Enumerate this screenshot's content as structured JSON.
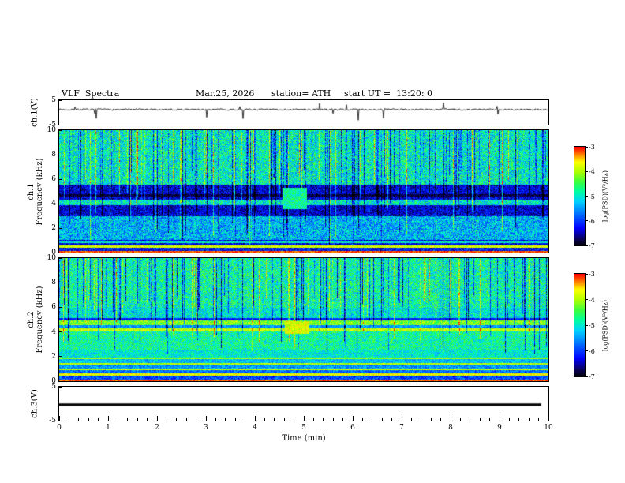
{
  "chart_data": {
    "type": "heatmap",
    "title": "VLF  Spectra",
    "header": {
      "date": "Mar.25, 2026",
      "station": "station= ATH",
      "start_ut": "start UT =  13:20: 0"
    },
    "xlabel": "Time  (min)",
    "x_range": [
      0,
      10
    ],
    "x_ticks": [
      0,
      1,
      2,
      3,
      4,
      5,
      6,
      7,
      8,
      9,
      10
    ],
    "x_minor_step": 0.2,
    "colorbar": {
      "label": "log(PSD)(V²/Hz)",
      "ticks": [
        -3,
        -4,
        -5,
        -6,
        -7
      ],
      "range": [
        -7,
        -3
      ]
    },
    "colormap_stops": [
      {
        "t": 0.0,
        "c": [
          0,
          0,
          0
        ]
      },
      {
        "t": 0.07,
        "c": [
          10,
          0,
          90
        ]
      },
      {
        "t": 0.18,
        "c": [
          0,
          0,
          255
        ]
      },
      {
        "t": 0.32,
        "c": [
          0,
          110,
          255
        ]
      },
      {
        "t": 0.45,
        "c": [
          0,
          210,
          255
        ]
      },
      {
        "t": 0.55,
        "c": [
          0,
          255,
          160
        ]
      },
      {
        "t": 0.65,
        "c": [
          60,
          255,
          60
        ]
      },
      {
        "t": 0.75,
        "c": [
          175,
          255,
          0
        ]
      },
      {
        "t": 0.85,
        "c": [
          255,
          255,
          0
        ]
      },
      {
        "t": 0.93,
        "c": [
          255,
          120,
          0
        ]
      },
      {
        "t": 1.0,
        "c": [
          255,
          0,
          0
        ]
      }
    ],
    "panels": [
      {
        "kind": "waveform",
        "ylabel": "ch.1(V)",
        "ylim": [
          -5,
          5
        ],
        "yticks": [
          5,
          -5
        ],
        "baseline": 1.2,
        "noise": 0.35,
        "spike_down_rate": 0.015,
        "spike_up_rate": 0.009,
        "seed": 7
      },
      {
        "kind": "spectrogram",
        "ylabel1": "ch.1",
        "ylabel2": "Frequency (kHz)",
        "ylim": [
          0,
          10
        ],
        "yticks": [
          0,
          2,
          4,
          6,
          8,
          10
        ],
        "seed": 11,
        "base": [
          -5.0,
          0.8
        ],
        "bands": [
          [
            0,
            0.15,
            -3.2,
            0.25
          ],
          [
            0.15,
            1.05,
            -6.2,
            0.55
          ],
          [
            0.45,
            0.62,
            -3.8,
            0.35
          ],
          [
            0.8,
            0.95,
            -5.0,
            0.5
          ],
          [
            1.05,
            3.0,
            -5.35,
            0.7
          ],
          [
            3.0,
            5.6,
            -6.35,
            0.5
          ],
          [
            3.9,
            4.35,
            -5.0,
            0.7
          ],
          [
            4.6,
            4.78,
            -6.8,
            0.25
          ],
          [
            5.6,
            10,
            -4.95,
            0.75
          ]
        ],
        "streaks": {
          "bright_rate": 0.1,
          "dark_rate": 0.16,
          "bright_delta": 1.25,
          "dark_delta": -1.35,
          "fmin": 0.6,
          "fmax": 7
        },
        "event": {
          "t0": 4.55,
          "t1": 5.05,
          "f0": 3.6,
          "f1": 5.3,
          "v": -4.8,
          "jit": 0.5
        }
      },
      {
        "kind": "spectrogram",
        "ylabel1": "ch.2",
        "ylabel2": "Frequency (kHz)",
        "ylim": [
          0,
          10
        ],
        "yticks": [
          0,
          2,
          4,
          6,
          8,
          10
        ],
        "seed": 23,
        "base": [
          -4.85,
          0.7
        ],
        "bands": [
          [
            0,
            0.15,
            -3.2,
            0.25
          ],
          [
            0.15,
            0.5,
            -5.9,
            0.5
          ],
          [
            0.5,
            0.65,
            -3.7,
            0.3
          ],
          [
            0.65,
            0.9,
            -5.7,
            0.45
          ],
          [
            0.9,
            1.05,
            -3.95,
            0.3
          ],
          [
            1.05,
            1.35,
            -5.5,
            0.45
          ],
          [
            1.35,
            1.5,
            -3.95,
            0.3
          ],
          [
            1.5,
            1.8,
            -5.3,
            0.45
          ],
          [
            1.8,
            1.95,
            -4.1,
            0.3
          ],
          [
            1.95,
            2.6,
            -5.0,
            0.5
          ],
          [
            2.6,
            4.1,
            -4.8,
            0.6
          ],
          [
            4.1,
            4.35,
            -3.9,
            0.4
          ],
          [
            4.35,
            4.6,
            -5.5,
            0.4
          ],
          [
            4.6,
            5.0,
            -4.2,
            0.5
          ],
          [
            5.0,
            5.15,
            -6.1,
            0.3
          ],
          [
            5.15,
            6.0,
            -5.05,
            0.6
          ],
          [
            6.0,
            10,
            -4.85,
            0.7
          ]
        ],
        "streaks": {
          "bright_rate": 0.07,
          "dark_rate": 0.15,
          "bright_delta": 1.1,
          "dark_delta": -1.5,
          "fmin": 2.2,
          "fmax": 7
        },
        "event": {
          "t0": 4.6,
          "t1": 5.1,
          "f0": 3.9,
          "f1": 4.9,
          "v": -3.8,
          "jit": 0.4
        }
      },
      {
        "kind": "flatline",
        "ylabel": "ch.3(V)",
        "ylim": [
          -5,
          5
        ],
        "yticks": [
          5,
          -5
        ],
        "value": -0.3,
        "thickness": 3,
        "end_fraction": 0.985
      }
    ]
  }
}
